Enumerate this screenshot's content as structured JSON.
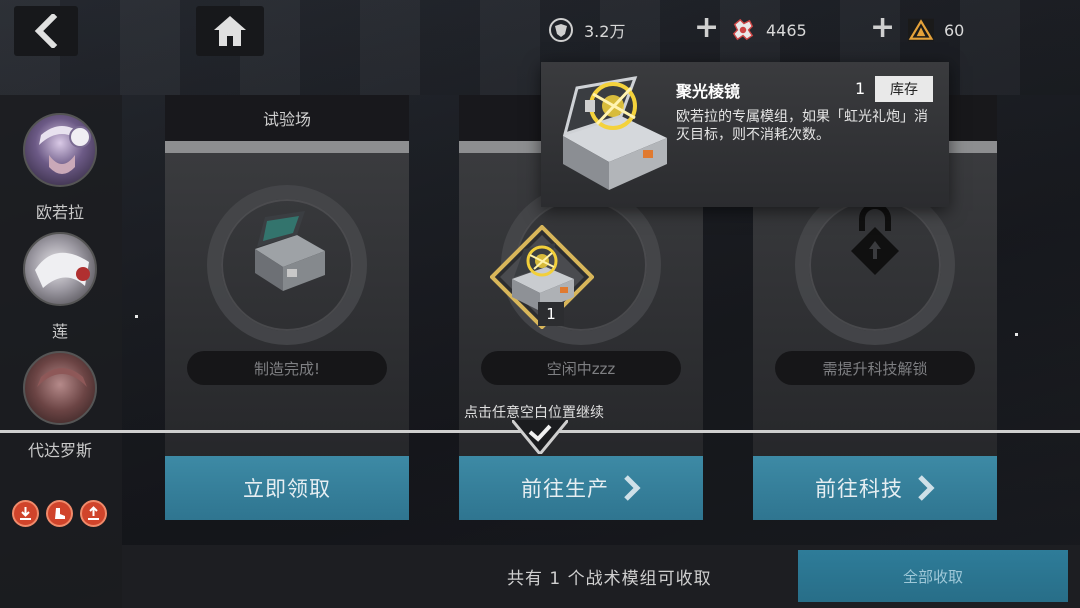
{
  "topbar": {
    "back_icon": "chevron-left-icon",
    "home_icon": "home-icon",
    "resources": [
      {
        "icon": "crest-icon",
        "value": "3.2万"
      },
      {
        "icon": "gear-parts-icon",
        "value": "4465"
      },
      {
        "icon": "triangle-crystal-icon",
        "value": "60"
      }
    ],
    "plus": "+"
  },
  "characters": [
    {
      "name": "欧若拉"
    },
    {
      "name": "莲"
    },
    {
      "name": "代达罗斯"
    }
  ],
  "panels": [
    {
      "title": "试验场",
      "status": "制造完成!",
      "button": "立即领取",
      "has_arrow": false
    },
    {
      "title": "",
      "status": "空闲中zzz",
      "button": "前往生产",
      "has_arrow": true
    },
    {
      "title": "",
      "status": "需提升科技解锁",
      "button": "前往科技",
      "has_arrow": true
    }
  ],
  "item": {
    "count": "1"
  },
  "tooltip": {
    "title": "聚光棱镜",
    "quantity": "1",
    "tag": "库存",
    "description": "欧若拉的专属模组，如果「虹光礼炮」消灭目标，则不消耗次数。"
  },
  "continue_tip": "点击任意空白位置继续",
  "bottom": {
    "summary": "共有  1 个战术模组可收取",
    "collect_all": "全部收取"
  },
  "colors": {
    "button_blue": "#2f7590",
    "badge_red": "#d0442b",
    "gold": "#e8c23a"
  }
}
